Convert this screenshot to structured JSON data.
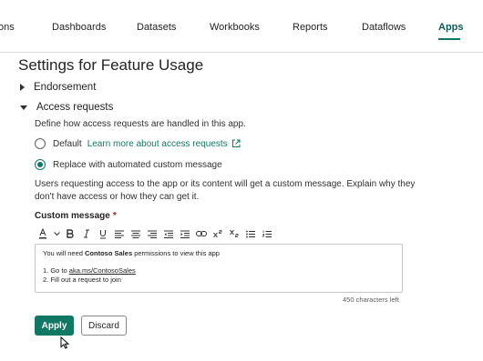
{
  "nav": {
    "tabs": [
      {
        "label": "ons"
      },
      {
        "label": "Dashboards"
      },
      {
        "label": "Datasets"
      },
      {
        "label": "Workbooks"
      },
      {
        "label": "Reports"
      },
      {
        "label": "Dataflows"
      },
      {
        "label": "Apps",
        "active": true
      }
    ]
  },
  "page": {
    "title": "Settings for Feature Usage"
  },
  "sections": {
    "endorsement": {
      "label": "Endorsement",
      "expanded": false
    },
    "access_requests": {
      "label": "Access requests",
      "expanded": true,
      "description": "Define how access requests are handled in this app.",
      "options": {
        "default": {
          "label": "Default",
          "selected": false,
          "link": "Learn more about access requests",
          "link_icon": "external-link-icon"
        },
        "custom": {
          "label": "Replace with automated custom message",
          "selected": true
        }
      },
      "explanation": "Users requesting access to the app or its content will get a custom message. Explain why they don't have access or how they can get it.",
      "custom_message": {
        "label": "Custom message",
        "required_mark": "*",
        "toolbar": [
          "font-color-icon",
          "chevron-down-icon",
          "bold-icon",
          "italic-icon",
          "underline-icon",
          "align-left-icon",
          "align-center-icon",
          "align-right-icon",
          "outdent-icon",
          "indent-icon",
          "link-icon",
          "superscript-icon",
          "subscript-icon",
          "bullet-list-icon",
          "numbered-list-icon"
        ],
        "line1_pre": "You will need ",
        "line1_bold": "Contoso Sales",
        "line1_post": " permissions to view this app",
        "item1_pre": "1. Go to ",
        "item1_link": "aka.ms/ContosoSales",
        "item2": "2. Fill out a request to join",
        "counter": "450 characters left"
      }
    }
  },
  "actions": {
    "apply_label": "Apply",
    "discard_label": "Discard"
  },
  "colors": {
    "accent": "#117865",
    "required": "#a4262c"
  }
}
